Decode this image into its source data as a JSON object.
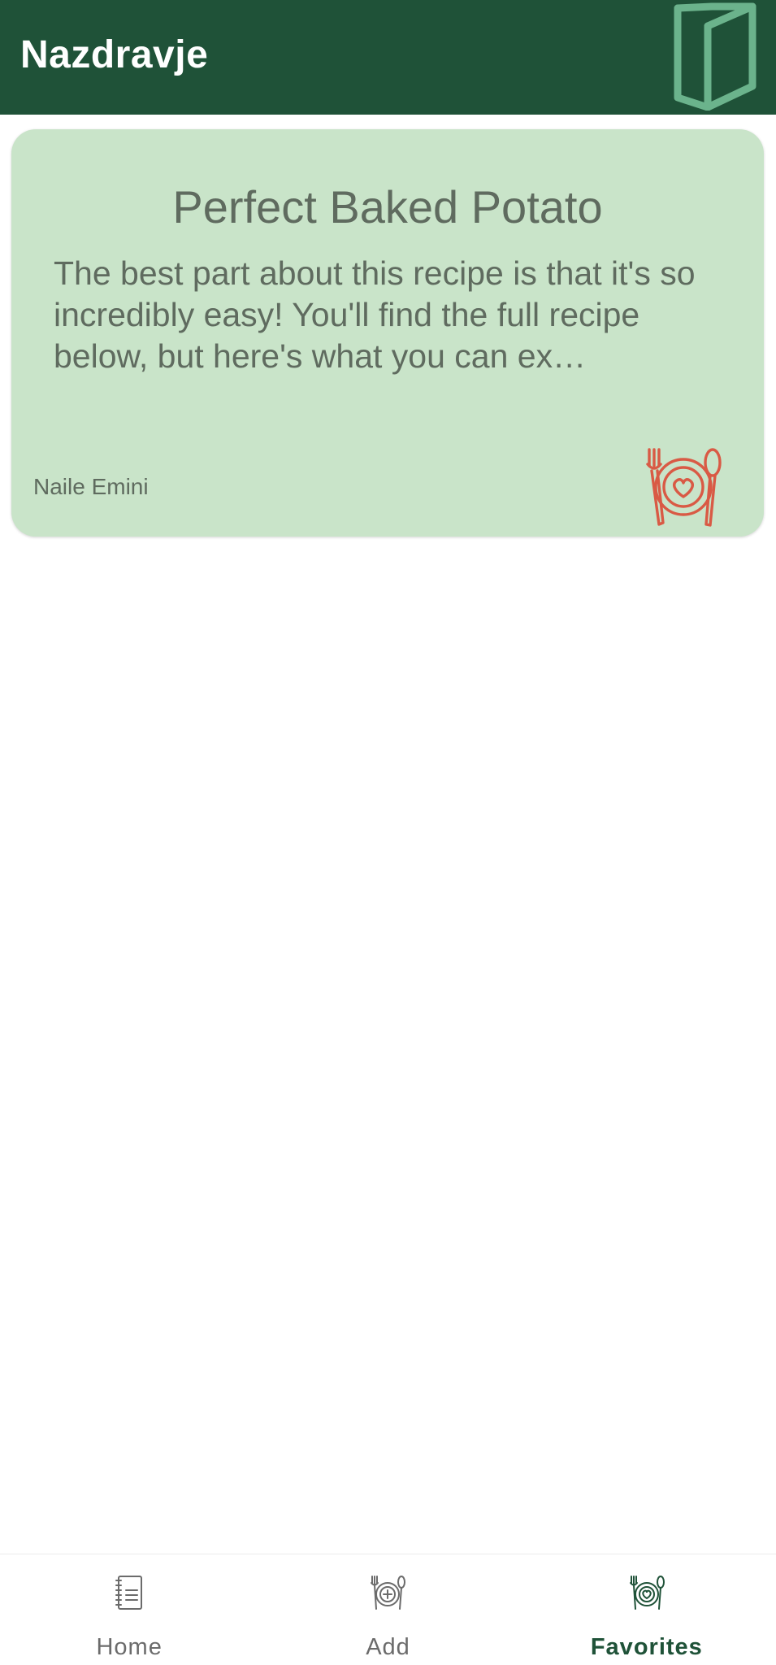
{
  "app_bar": {
    "title": "Nazdravje",
    "action_icon": "book-icon"
  },
  "recipes": [
    {
      "title": "Perfect Baked Potato",
      "description": "The best part about this recipe is that it's so incredibly easy! You'll find the full recipe below, but here's what you can ex…",
      "author": "Naile Emini",
      "favorite_icon": "plate-heart-icon"
    }
  ],
  "bottom_nav": {
    "items": [
      {
        "label": "Home",
        "icon": "notebook-icon",
        "active": false
      },
      {
        "label": "Add",
        "icon": "plate-plus-icon",
        "active": false
      },
      {
        "label": "Favorites",
        "icon": "plate-heart-icon",
        "active": true
      }
    ]
  },
  "colors": {
    "app_bar": "#1f5238",
    "card_background": "#c9e4c9",
    "text_muted": "#5f6b5f",
    "favorite_accent": "#d95a45",
    "book_icon": "#6bb38c",
    "nav_active": "#1f5238",
    "nav_inactive": "#6b6b6b"
  }
}
